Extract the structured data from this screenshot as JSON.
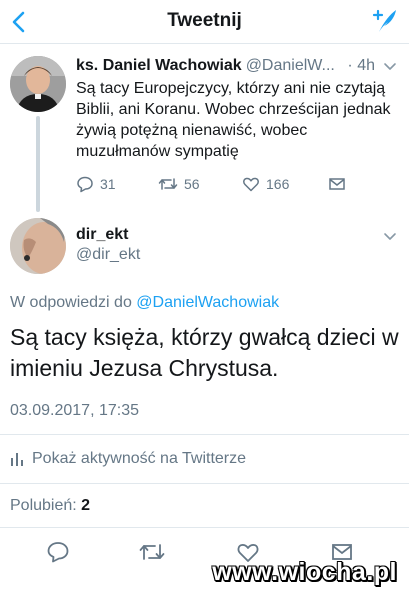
{
  "header": {
    "title": "Tweetnij"
  },
  "parent_tweet": {
    "name": "ks. Daniel Wachowiak",
    "handle": "@DanielW...",
    "time": "· 4h",
    "text": "Są tacy Europejczycy, którzy ani nie czytają Biblii, ani Koranu. Wobec chrześcijan jednak żywią potężną nienawiść, wobec muzułmanów sympatię",
    "replies": "31",
    "retweets": "56",
    "likes": "166"
  },
  "reply_tweet": {
    "name": "dir_ekt",
    "handle": "@dir_ekt",
    "reply_prefix": "W odpowiedzi do",
    "reply_mention": "@DanielWachowiak",
    "text": "Są tacy księża, którzy gwałcą dzieci w imieniu Jezusa Chrystusa.",
    "date": "03.09.2017, 17:35",
    "activity_label": "Pokaż aktywność na Twitterze",
    "likes_label": "Polubień:",
    "likes_count": "2"
  },
  "watermark": "www.wiocha.pl",
  "colors": {
    "accent": "#1da1f2",
    "secondary_text": "#657786",
    "divider": "#e1e8ed"
  }
}
